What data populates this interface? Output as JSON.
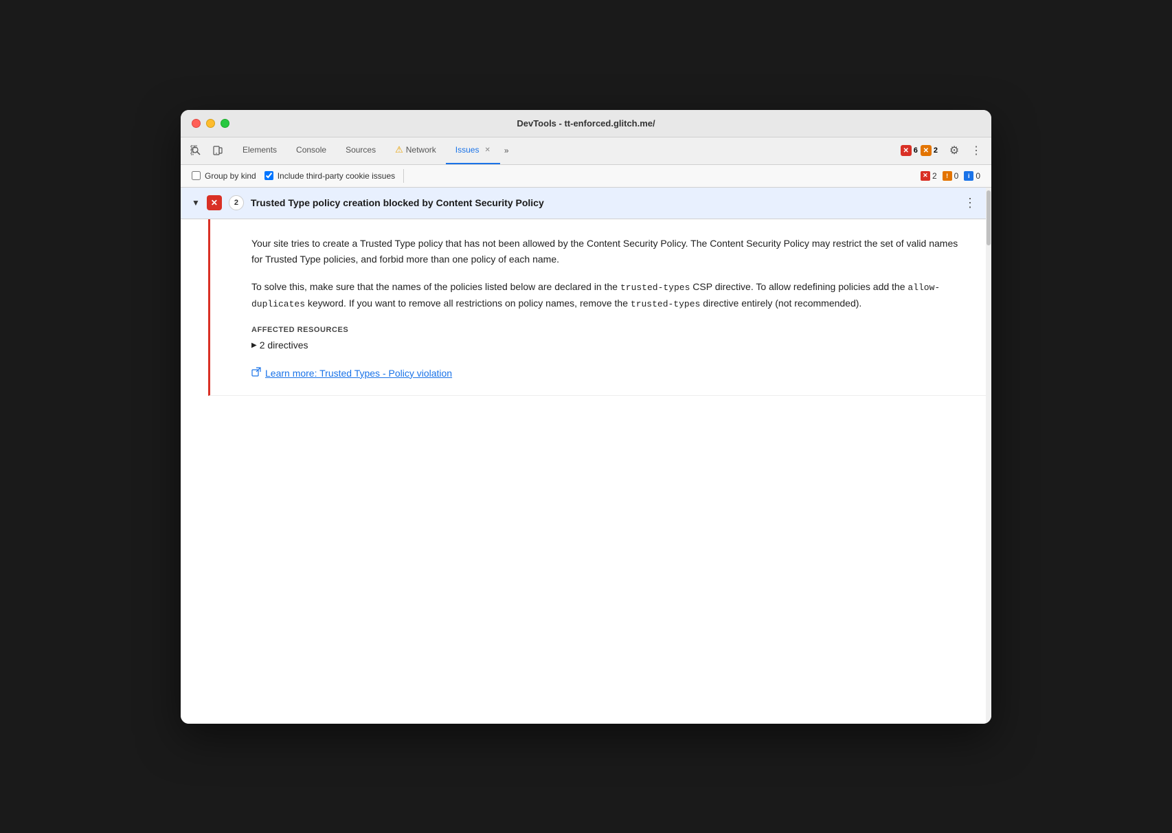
{
  "window": {
    "title": "DevTools - tt-enforced.glitch.me/"
  },
  "toolbar": {
    "icon_inspect": "⬚",
    "icon_device": "▭",
    "tabs": [
      {
        "id": "elements",
        "label": "Elements",
        "active": false
      },
      {
        "id": "console",
        "label": "Console",
        "active": false
      },
      {
        "id": "sources",
        "label": "Sources",
        "active": false
      },
      {
        "id": "network",
        "label": "Network",
        "active": false,
        "has_warning": true
      },
      {
        "id": "issues",
        "label": "Issues",
        "active": true,
        "has_close": true
      }
    ],
    "tab_more": "»",
    "badge_error_count": "6",
    "badge_warning_count": "2",
    "gear_icon": "⚙",
    "more_icon": "⋮"
  },
  "filter_bar": {
    "group_by_kind_label": "Group by kind",
    "group_by_kind_checked": false,
    "include_third_party_label": "Include third-party cookie issues",
    "include_third_party_checked": true,
    "badge_error_count": "2",
    "badge_warning_count": "0",
    "badge_info_count": "0"
  },
  "issue": {
    "badge_icon": "✕",
    "count": "2",
    "title": "Trusted Type policy creation blocked by Content Security Policy",
    "description_para1": "Your site tries to create a Trusted Type policy that has not been allowed by the Content Security Policy. The Content Security Policy may restrict the set of valid names for Trusted Type policies, and forbid more than one policy of each name.",
    "description_para2_prefix": "To solve this, make sure that the names of the policies listed below are declared in the ",
    "description_para2_code1": "trusted-types",
    "description_para2_middle": " CSP directive. To allow redefining policies add the ",
    "description_para2_code2": "allow-\nduplicates",
    "description_para2_suffix": " keyword. If you want to remove all restrictions on policy names, remove the ",
    "description_para2_code3": "trusted-types",
    "description_para2_end": " directive entirely (not recommended).",
    "affected_label": "AFFECTED RESOURCES",
    "directives_label": "2 directives",
    "learn_more_text": "Learn more: Trusted Types - Policy violation",
    "learn_more_url": "#"
  }
}
